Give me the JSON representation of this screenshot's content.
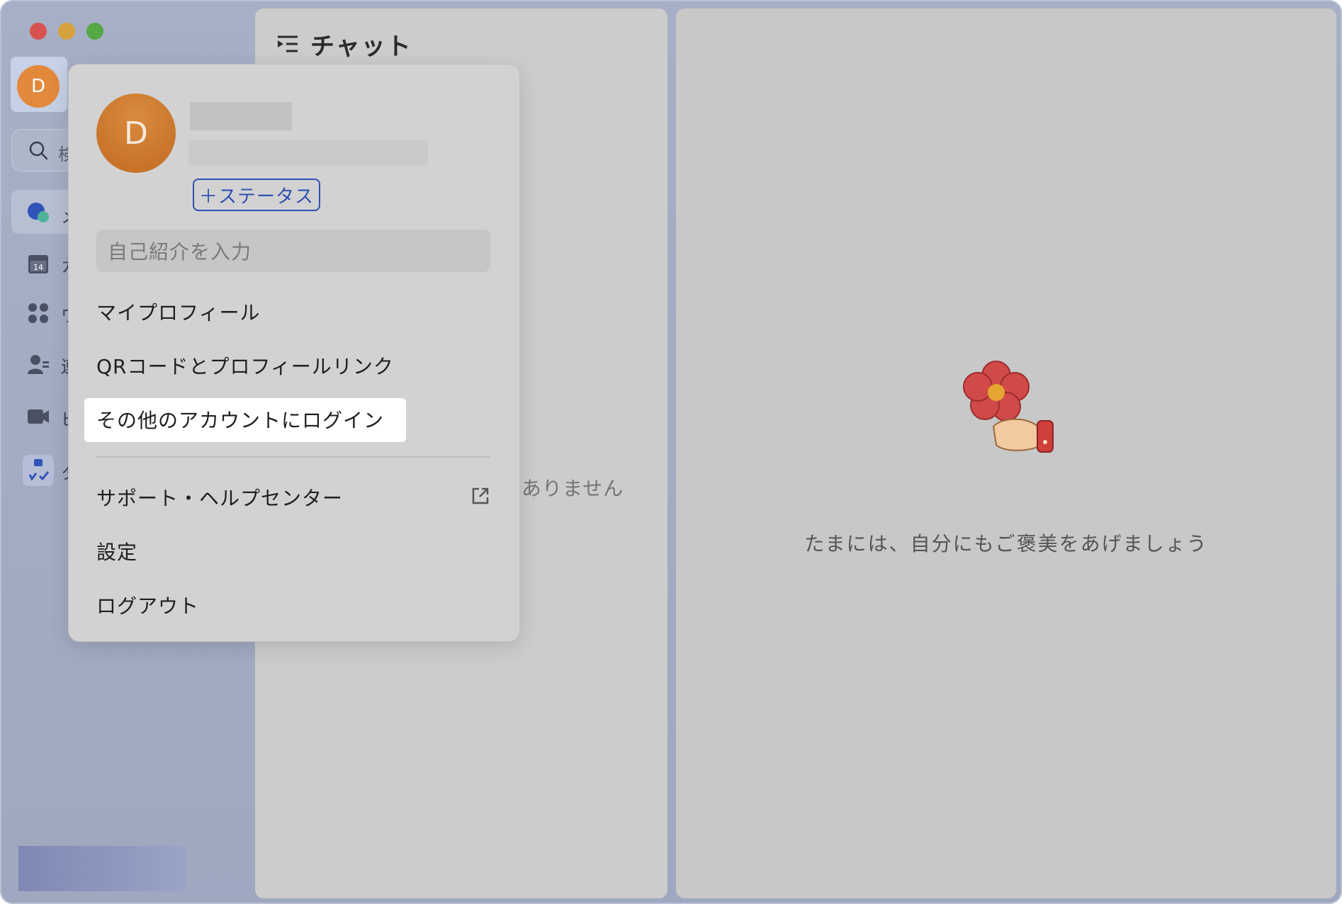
{
  "window": {
    "traffic_lights": [
      "close",
      "minimize",
      "maximize"
    ]
  },
  "rail": {
    "avatar_initial": "D",
    "search_partial": "検",
    "items": [
      {
        "icon": "chat-bubble-icon",
        "partial_label": "メ"
      },
      {
        "icon": "calendar-icon",
        "badge": "14",
        "partial_label": "カ"
      },
      {
        "icon": "apps-grid-icon",
        "partial_label": "ワ"
      },
      {
        "icon": "contacts-icon",
        "partial_label": "連"
      },
      {
        "icon": "video-camera-icon",
        "partial_label": "ビ"
      },
      {
        "icon": "tasks-icon",
        "partial_label": "タ"
      }
    ]
  },
  "chat": {
    "title": "チャット",
    "empty_partial": "ありません"
  },
  "main": {
    "message": "たまには、自分にもご褒美をあげましょう",
    "illustration": "flower-in-hand"
  },
  "popup": {
    "avatar_initial": "D",
    "status_button": "＋ステータス",
    "bio_placeholder": "自己紹介を入力",
    "menu": {
      "my_profile": "マイプロフィール",
      "qr_profile_link": "QRコードとプロフィールリンク",
      "login_other": "その他のアカウントにログイン",
      "support": "サポート・ヘルプセンター",
      "settings": "設定",
      "logout": "ログアウト"
    }
  },
  "colors": {
    "accent_blue": "#2f4fb1",
    "avatar_orange": "#e2893c"
  }
}
